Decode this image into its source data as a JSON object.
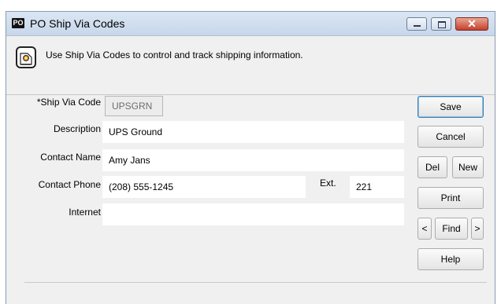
{
  "window": {
    "app_icon": "PO",
    "title": "PO Ship Via Codes"
  },
  "info": {
    "icon": "document-gear-icon",
    "text": "Use Ship Via Codes to control and track shipping information."
  },
  "form": {
    "ship_via_code": {
      "label": "*Ship Via Code",
      "value": "UPSGRN"
    },
    "description": {
      "label": "Description",
      "value": "UPS Ground"
    },
    "contact_name": {
      "label": "Contact Name",
      "value": "Amy Jans"
    },
    "contact_phone": {
      "label": "Contact Phone",
      "value": "(208) 555-1245"
    },
    "ext": {
      "label": "Ext.",
      "value": "221"
    },
    "internet": {
      "label": "Internet",
      "value": ""
    }
  },
  "buttons": {
    "save": "Save",
    "cancel": "Cancel",
    "del": "Del",
    "new": "New",
    "print": "Print",
    "prev": "<",
    "find": "Find",
    "next": ">",
    "help": "Help"
  },
  "colors": {
    "titlebar": "#c7d7ea",
    "window_bg": "#f0f0f0",
    "close_button": "#c4412a"
  }
}
